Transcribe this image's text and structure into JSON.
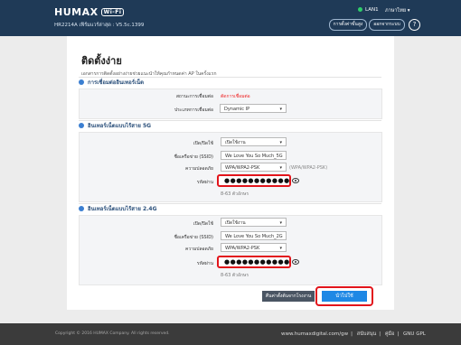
{
  "header": {
    "logo": "HUMAX",
    "logo_badge": "Wi-Fi",
    "firmware": "HR2214A เฟิร์มแวร์ล่าสุด : V5.5c.1399",
    "lan_status": "LAN1",
    "language": "ภาษาไทย",
    "btn1": "การตั้งค่าขั้นสูง",
    "btn2": "ออกจากระบบ",
    "help": "?"
  },
  "page": {
    "title": "ติดตั้งง่าย",
    "description": "เอกสารการติดตั้งอย่างง่ายช่วยแนะนำให้คุณกำหนดค่า AP ในครั้งแรก"
  },
  "internet": {
    "header": "การเชื่อมต่ออินเทอร์เน็ต",
    "status_label": "สถานะการเชื่อมต่อ",
    "status_value": "ตัดการเชื่อมต่อ",
    "type_label": "ประเภทการเชื่อมต่อ",
    "type_value": "Dynamic IP"
  },
  "wifi5": {
    "header": "อินเทอร์เน็ตแบบไร้สาย 5G",
    "enable_label": "เปิด/ปิดใช้",
    "enable_value": "เปิดใช้งาน",
    "ssid_label": "ชื่อเครือข่าย (SSID)",
    "ssid_value": "We Love You So Much_5G",
    "security_label": "ความปลอดภัย",
    "security_value": "WPA/WPA2-PSK",
    "security_note": "(WPA/WPA2-PSK)",
    "password_label": "รหัสผ่าน",
    "password_value": "●●●●●●●●●●●",
    "password_hint": "8-63 ตัวอักษร"
  },
  "wifi24": {
    "header": "อินเทอร์เน็ตแบบไร้สาย 2.4G",
    "enable_label": "เปิด/ปิดใช้",
    "enable_value": "เปิดใช้งาน",
    "ssid_label": "ชื่อเครือข่าย (SSID)",
    "ssid_value": "We Love You So Much_2G",
    "security_label": "ความปลอดภัย",
    "security_value": "WPA/WPA2-PSK",
    "password_label": "รหัสผ่าน",
    "password_value": "●●●●●●●●●●●",
    "password_hint": "8-63 ตัวอักษร"
  },
  "actions": {
    "reset": "คืนค่าตั้งต้นจากโรงงาน",
    "apply": "นำไปใช้"
  },
  "footer": {
    "copyright": "Copyright © 2016 HUMAX Company. All rights reserved.",
    "website": "www.humaxdigital.com/gw",
    "link1": "สนับสนุน",
    "link2": "คู่มือ",
    "link3": "GNU GPL"
  },
  "colors": {
    "header_bg": "#1f3a57",
    "highlight": "#e2141b",
    "apply": "#1e88e5"
  }
}
